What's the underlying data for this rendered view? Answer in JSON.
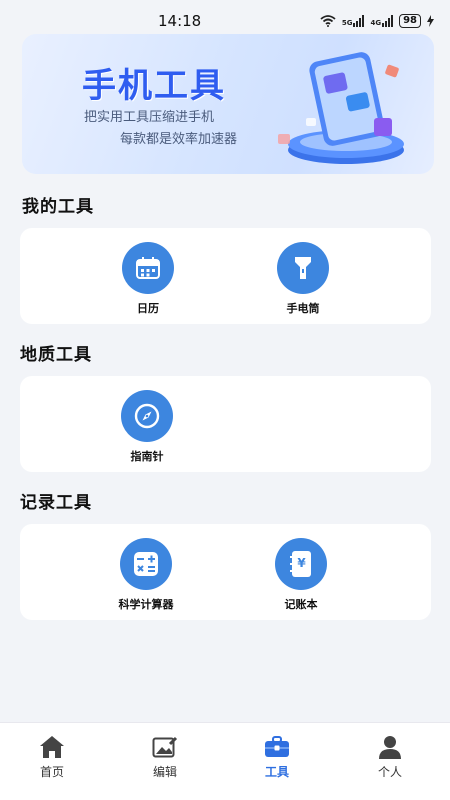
{
  "status": {
    "time": "14:18",
    "battery": "98",
    "net1": "5G",
    "net2": "4G"
  },
  "banner": {
    "title": "手机工具",
    "line1": "把实用工具压缩进手机",
    "line2": "每款都是效率加速器"
  },
  "sections": [
    {
      "title": "我的工具",
      "tools": [
        {
          "label": "日历",
          "icon": "calendar-icon"
        },
        {
          "label": "手电筒",
          "icon": "flashlight-icon"
        }
      ]
    },
    {
      "title": "地质工具",
      "tools": [
        {
          "label": "指南针",
          "icon": "compass-icon"
        }
      ]
    },
    {
      "title": "记录工具",
      "tools": [
        {
          "label": "科学计算器",
          "icon": "calculator-icon"
        },
        {
          "label": "记账本",
          "icon": "ledger-icon"
        }
      ]
    }
  ],
  "tabs": [
    {
      "label": "首页",
      "icon": "home-icon",
      "active": false
    },
    {
      "label": "编辑",
      "icon": "edit-icon",
      "active": false
    },
    {
      "label": "工具",
      "icon": "toolbox-icon",
      "active": true
    },
    {
      "label": "个人",
      "icon": "person-icon",
      "active": false
    }
  ],
  "colors": {
    "accent": "#3d86df",
    "active_tab": "#2f6fe0",
    "banner_title": "#2f5df0"
  }
}
